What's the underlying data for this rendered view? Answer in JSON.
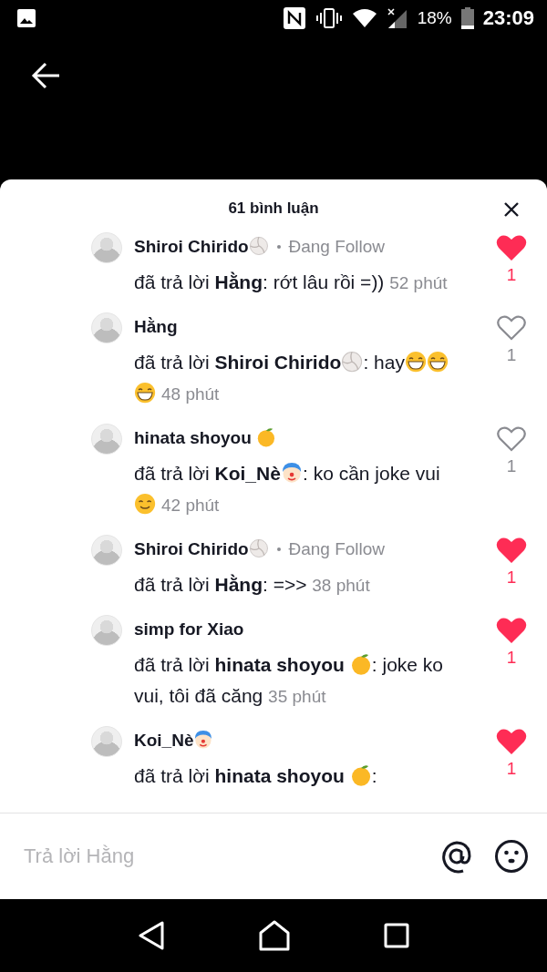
{
  "status_bar": {
    "battery": "18%",
    "time": "23:09"
  },
  "sheet": {
    "title": "61 bình luận",
    "comments": [
      {
        "name": "Shiroi Chirido",
        "name_badge": {
          "kind": "volleyball"
        },
        "follow": "Đang Follow",
        "liked": true,
        "likes": "1",
        "time": "52 phút",
        "body": [
          {
            "kind": "text",
            "text": "đã trả lời "
          },
          {
            "kind": "mention",
            "text": "Hằng"
          },
          {
            "kind": "text",
            "text": ": rớt lâu rồi =))"
          }
        ]
      },
      {
        "name": "Hằng",
        "liked": false,
        "likes": "1",
        "time": "48 phút",
        "body": [
          {
            "kind": "text",
            "text": "đã trả lời "
          },
          {
            "kind": "mention",
            "text": "Shiroi Chirido"
          },
          {
            "kind": "volleyball"
          },
          {
            "kind": "text",
            "text": ": hay"
          },
          {
            "kind": "laughing"
          },
          {
            "kind": "laughing"
          },
          {
            "kind": "laughing"
          }
        ]
      },
      {
        "name": "hinata shoyou ",
        "name_badge": {
          "kind": "citrus"
        },
        "liked": false,
        "likes": "1",
        "time": "42 phút",
        "body": [
          {
            "kind": "text",
            "text": "đã trả lời "
          },
          {
            "kind": "mention",
            "text": "Koi_Nè"
          },
          {
            "kind": "clown"
          },
          {
            "kind": "text",
            "text": ": ko cần joke vui "
          },
          {
            "kind": "smile"
          }
        ]
      },
      {
        "name": "Shiroi Chirido",
        "name_badge": {
          "kind": "volleyball"
        },
        "follow": "Đang Follow",
        "liked": true,
        "likes": "1",
        "time": "38 phút",
        "body": [
          {
            "kind": "text",
            "text": "đã trả lời "
          },
          {
            "kind": "mention",
            "text": "Hằng"
          },
          {
            "kind": "text",
            "text": ": =>>"
          }
        ]
      },
      {
        "name": "simp for Xiao",
        "liked": true,
        "likes": "1",
        "time": "35 phút",
        "body": [
          {
            "kind": "text",
            "text": "đã trả lời "
          },
          {
            "kind": "mention",
            "text": "hinata shoyou "
          },
          {
            "kind": "citrus"
          },
          {
            "kind": "text",
            "text": ": joke ko vui, tôi đã căng"
          }
        ]
      },
      {
        "name": "Koi_Nè",
        "name_badge": {
          "kind": "clown"
        },
        "liked": true,
        "likes": "1",
        "body": [
          {
            "kind": "text",
            "text": "đã trả lời "
          },
          {
            "kind": "mention",
            "text": "hinata shoyou "
          },
          {
            "kind": "citrus"
          },
          {
            "kind": "text",
            "text": ":"
          }
        ]
      }
    ]
  },
  "reply": {
    "placeholder": "Trả lời Hằng"
  }
}
